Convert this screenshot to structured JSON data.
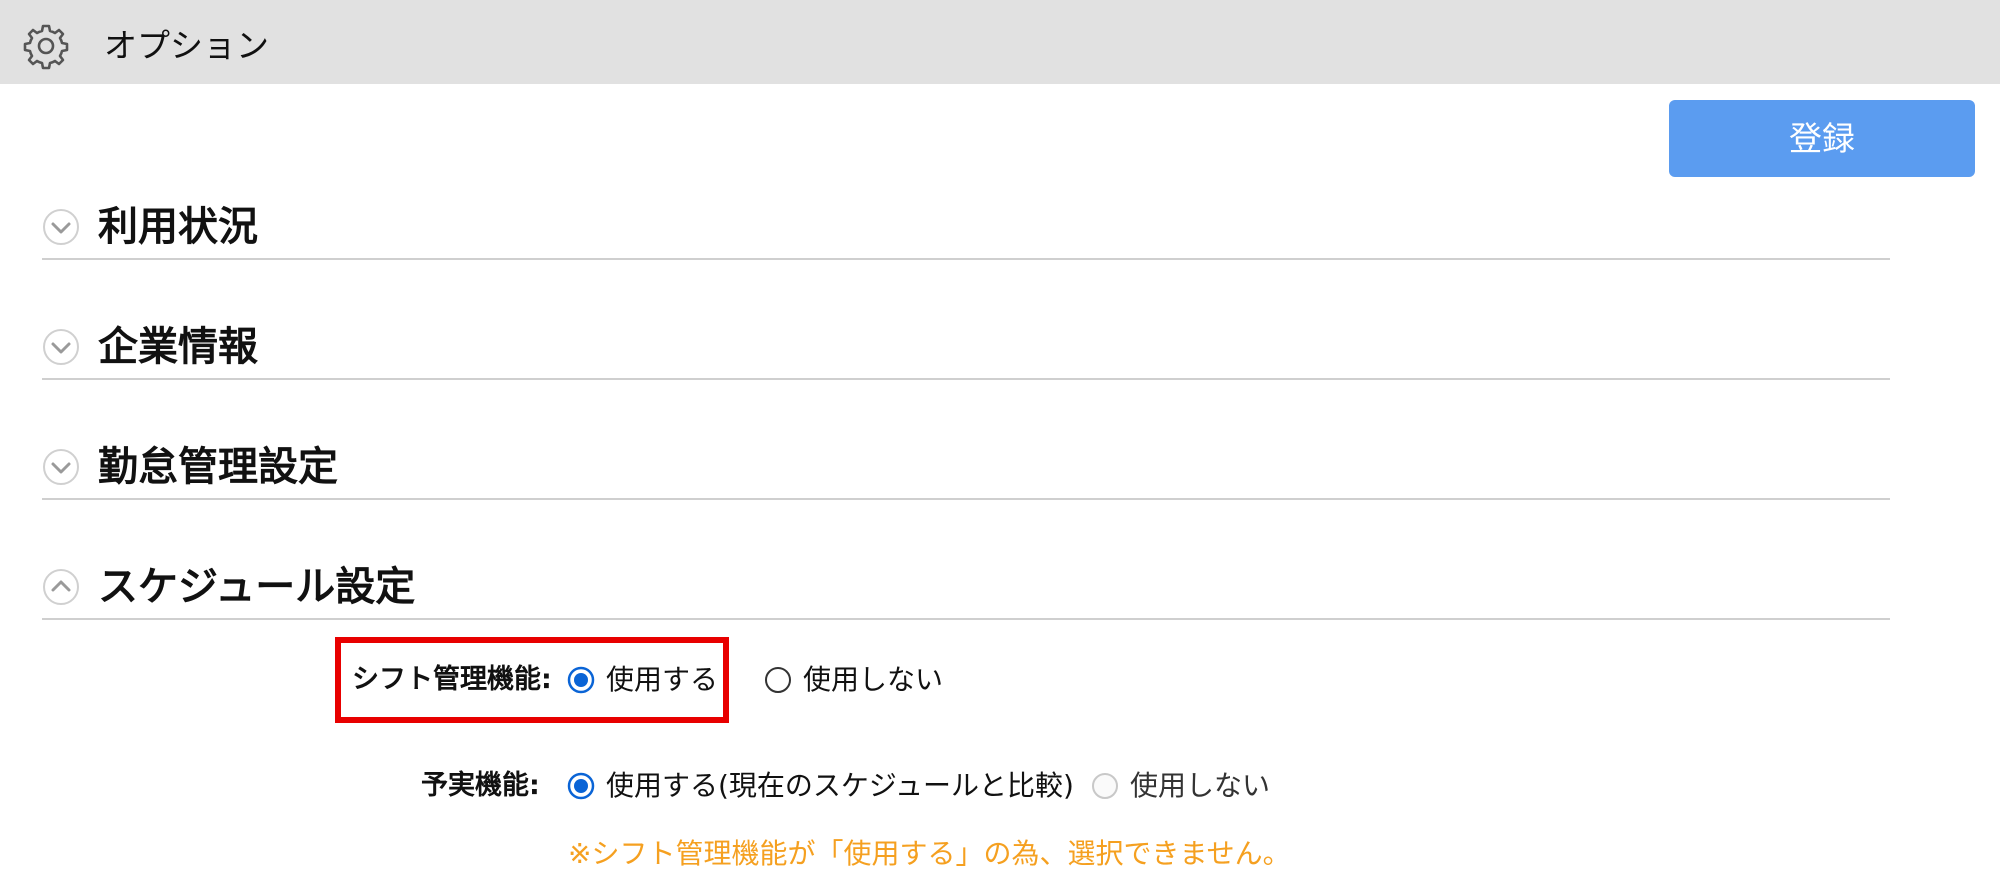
{
  "header": {
    "icon": "gear-icon",
    "title": "オプション"
  },
  "toolbar": {
    "register_label": "登録"
  },
  "sections": [
    {
      "title": "利用状況",
      "state": "collapsed"
    },
    {
      "title": "企業情報",
      "state": "collapsed"
    },
    {
      "title": "勤怠管理設定",
      "state": "collapsed"
    },
    {
      "title": "スケジュール設定",
      "state": "expanded"
    }
  ],
  "schedule": {
    "shift": {
      "label": "シフト管理機能:",
      "options": [
        "使用する",
        "使用しない"
      ],
      "selected": 0
    },
    "yojitsu": {
      "label": "予実機能:",
      "options": [
        "使用する(現在のスケジュールと比較)",
        "使用しない"
      ],
      "selected": 0,
      "disabled": true
    },
    "note": "※シフト管理機能が「使用する」の為、選択できません。"
  },
  "colors": {
    "accent": "#5b9cf0",
    "radio_selected": "#0a64d6",
    "highlight": "#e80000",
    "note": "#f5a020",
    "titlebar": "#e1e1e1"
  }
}
